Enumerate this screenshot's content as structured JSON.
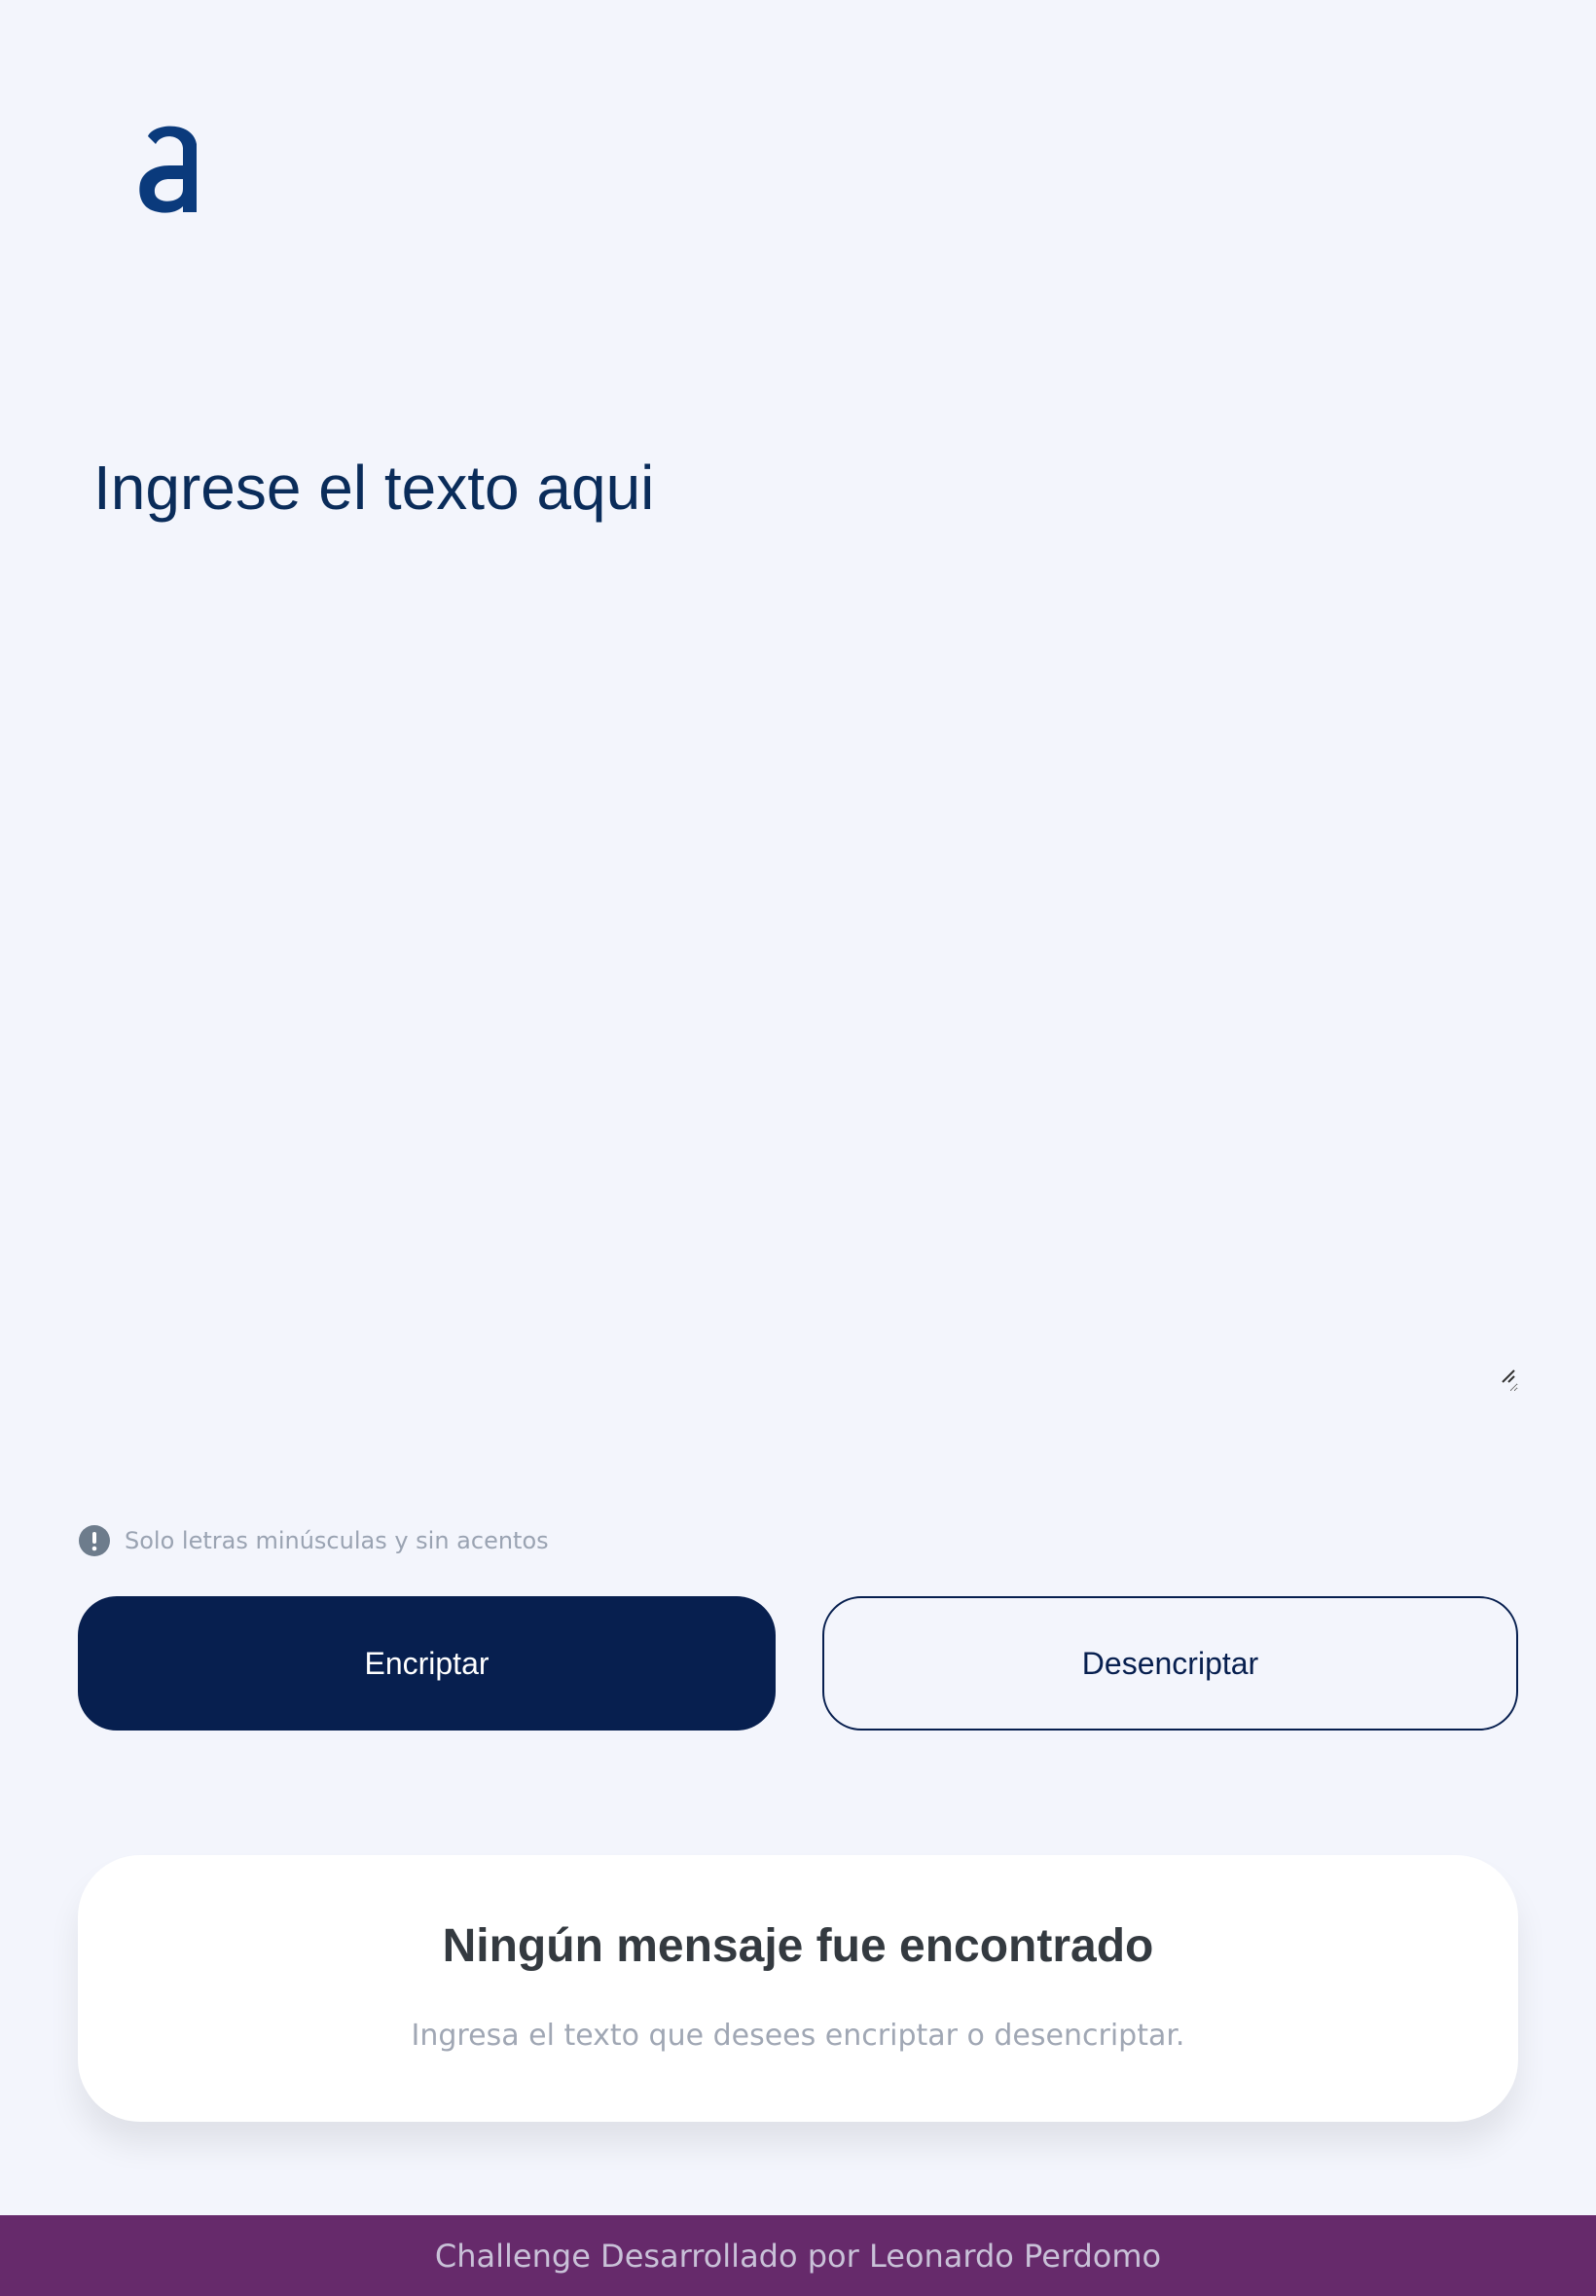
{
  "logo": {
    "letter": "a",
    "color": "#0a3a7c"
  },
  "input": {
    "placeholder": "Ingrese el texto aqui",
    "value": ""
  },
  "hint": {
    "icon": "exclamation-circle-icon",
    "text": "Solo letras minúsculas y sin acentos"
  },
  "buttons": {
    "encrypt_label": "Encriptar",
    "decrypt_label": "Desencriptar"
  },
  "result": {
    "title": "Ningún mensaje fue encontrado",
    "subtitle": "Ingresa el texto que desees encriptar o desencriptar."
  },
  "footer": {
    "text": "Challenge Desarrollado por Leonardo Perdomo"
  },
  "colors": {
    "background": "#f3f5fc",
    "primary": "#071f4f",
    "footer": "#662a6b"
  }
}
